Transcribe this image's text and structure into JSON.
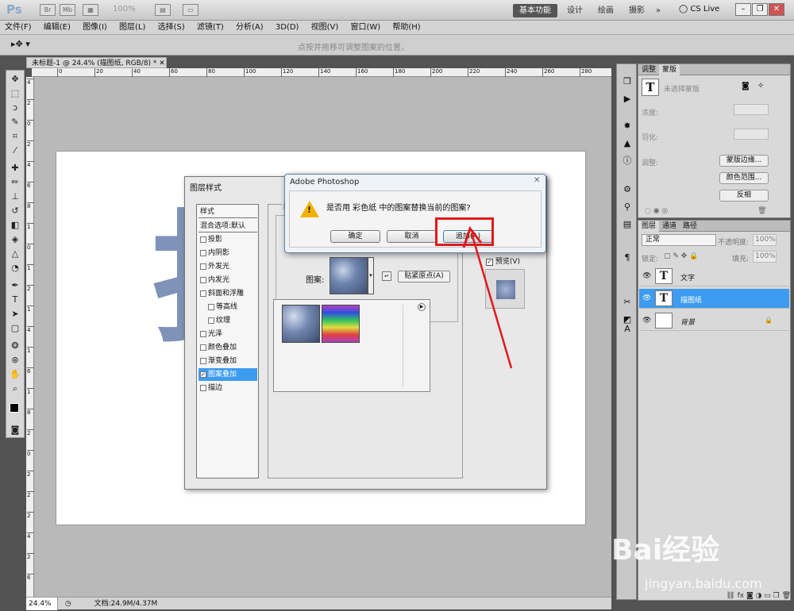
{
  "app": {
    "logo": "Ps",
    "zoom": "100%",
    "workspaces": [
      "基本功能",
      "设计",
      "绘画",
      "摄影"
    ],
    "more": "»",
    "cslive": "CS Live"
  },
  "menu": [
    "文件(F)",
    "编辑(E)",
    "图像(I)",
    "图层(L)",
    "选择(S)",
    "滤镜(T)",
    "分析(A)",
    "3D(D)",
    "视图(V)",
    "窗口(W)",
    "帮助(H)"
  ],
  "options": {
    "hint": "点按并拖移可调整图案的位置。"
  },
  "document": {
    "tab": "未标题-1 @ 24.4% (描图纸, RGB/8) *",
    "zoom": "24.4%",
    "docinfo": "文档:24.9M/4.37M",
    "glyph": "打"
  },
  "ruler": {
    "h": [
      "0",
      "20",
      "40",
      "60",
      "80",
      "100",
      "120",
      "140",
      "160",
      "180",
      "200",
      "220",
      "240",
      "260",
      "280"
    ],
    "v": [
      "4",
      "2",
      "0",
      "2",
      "4",
      "6",
      "8",
      "1",
      "0",
      "1",
      "2",
      "1",
      "4",
      "1",
      "6",
      "1",
      "8",
      "2",
      "0",
      "2",
      "2",
      "2",
      "4",
      "2",
      "6"
    ]
  },
  "adjust_panel": {
    "tabs": [
      "调整",
      "蒙版"
    ],
    "mask_label": "未选择蒙版",
    "density": "浓度:",
    "feather": "羽化:",
    "refine": "调整:",
    "btn_edge": "蒙版边缘...",
    "btn_color": "颜色范围...",
    "btn_invert": "反相"
  },
  "layers_panel": {
    "tabs": [
      "图层",
      "通道",
      "路径"
    ],
    "blend": "正常",
    "opacity_label": "不透明度:",
    "opacity": "100%",
    "lock_label": "锁定:",
    "fill_label": "填充:",
    "fill": "100%",
    "layers": [
      {
        "name": "文字",
        "thumb": "T"
      },
      {
        "name": "描图纸",
        "thumb": "T"
      },
      {
        "name": "背景",
        "thumb": ""
      }
    ]
  },
  "layer_style": {
    "title": "图层样式",
    "styles_header": "样式",
    "blend_default": "混合选项:默认",
    "items": [
      "投影",
      "内阴影",
      "外发光",
      "内发光",
      "斜面和浮雕",
      "等高线",
      "纹理",
      "光泽",
      "颜色叠加",
      "渐变叠加",
      "图案叠加",
      "描边"
    ],
    "checked": "图案叠加",
    "group_initial": "图",
    "pattern_label": "图案:",
    "snap_btn": "贴紧原点(A)",
    "preview": "预览(V)"
  },
  "alert": {
    "title": "Adobe Photoshop",
    "message": "是否用 彩色纸 中的图案替换当前的图案?",
    "ok": "确定",
    "cancel": "取消",
    "append": "追加(A)"
  },
  "watermark": {
    "brand": "Bai经验",
    "url": "jingyan.baidu.com"
  },
  "colors": {
    "highlight": "#e01a1a",
    "selection": "#3d9bf0",
    "warn": "#f3b200"
  }
}
